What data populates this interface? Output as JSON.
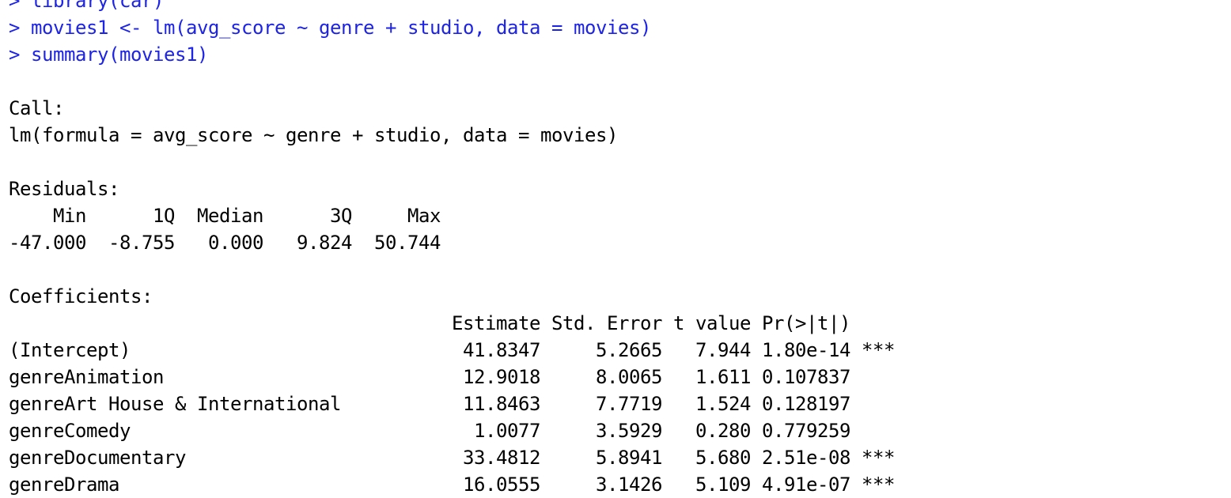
{
  "console": {
    "partial_top_line": "> library(car)",
    "commands": [
      {
        "prompt": "> ",
        "text": "movies1 <- lm(avg_score ~ genre + studio, data = movies)"
      },
      {
        "prompt": "> ",
        "text": "summary(movies1)"
      }
    ],
    "call_label": "Call:",
    "call_text": "lm(formula = avg_score ~ genre + studio, data = movies)",
    "residuals_label": "Residuals:",
    "residuals_header": "    Min      1Q  Median      3Q     Max ",
    "residuals_values": "-47.000  -8.755   0.000   9.824  50.744 ",
    "coefficients_label": "Coefficients:",
    "coefficients_header": "                                        Estimate Std. Error t value Pr(>|t|)    ",
    "coefficients_rows": [
      "(Intercept)                              41.8347     5.2665   7.944 1.80e-14 ***",
      "genreAnimation                           12.9018     8.0065   1.611 0.107837    ",
      "genreArt House & International           11.8463     7.7719   1.524 0.128197    ",
      "genreComedy                               1.0077     3.5929   0.280 0.779259    ",
      "genreDocumentary                         33.4812     5.8941   5.680 2.51e-08 ***",
      "genreDrama                               16.0555     3.1426   5.109 4.91e-07 ***"
    ]
  },
  "colors": {
    "command": "#1e24e6",
    "output": "#000000",
    "background": "#ffffff"
  }
}
